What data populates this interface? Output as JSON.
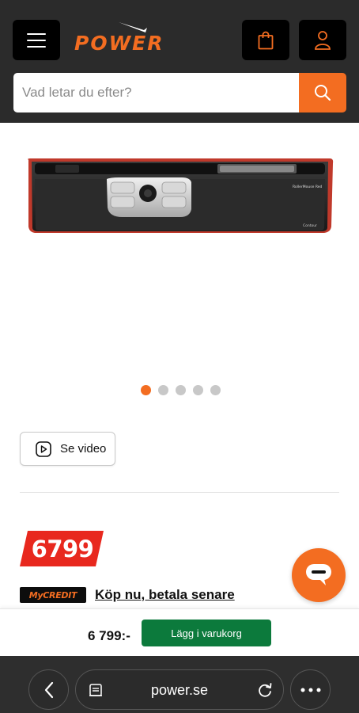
{
  "header": {
    "logo_text": "POWER",
    "brand_color": "#f36d21",
    "icons": [
      "menu-icon",
      "shopping-bag-icon",
      "user-icon",
      "search-icon"
    ]
  },
  "search": {
    "placeholder": "Vad letar du efter?"
  },
  "product": {
    "image_label": "RollerMouse Red",
    "image_brand": "Contour",
    "carousel": {
      "total": 5,
      "active": 1
    }
  },
  "video_button": {
    "label": "Se video",
    "icon": "play-icon"
  },
  "price": {
    "value": "6799",
    "tag_color": "#e8281e"
  },
  "credit": {
    "logo_text": "MyCREDIT",
    "link": "Köp nu, betala senare"
  },
  "chat": {
    "icon": "chat-icon"
  },
  "cart_bar": {
    "price": "6 799:-",
    "button": "Lägg i varukorg",
    "button_color": "#0c7a3c"
  },
  "browser": {
    "url": "power.se",
    "icons": [
      "back-arrow-icon",
      "reader-icon",
      "reload-icon",
      "more-icon"
    ]
  }
}
